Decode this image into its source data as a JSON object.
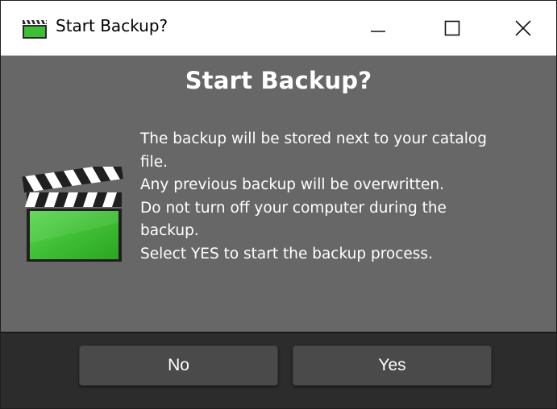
{
  "window": {
    "title": "Start Backup?",
    "controls": {
      "minimize_icon": "minimize-icon",
      "maximize_icon": "maximize-icon",
      "close_icon": "close-icon"
    }
  },
  "dialog": {
    "heading": "Start Backup?",
    "icon": "clapperboard-icon",
    "message_lines": [
      "The backup will be stored next to your catalog",
      "file.",
      "Any previous backup will be overwritten.",
      "Do not turn off your computer during the",
      "backup.",
      "Select YES to start the backup process."
    ]
  },
  "buttons": {
    "no_label": "No",
    "yes_label": "Yes"
  },
  "colors": {
    "content_bg": "#676767",
    "footer_bg": "#2c2c2c",
    "button_bg": "#4a4a4a",
    "clapper_green": "#3ec43a"
  }
}
